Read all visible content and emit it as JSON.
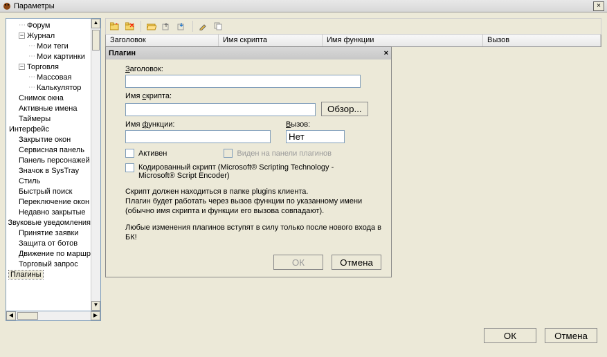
{
  "window": {
    "title": "Параметры",
    "close": "×"
  },
  "tree": {
    "items": [
      {
        "level": 1,
        "expander": "",
        "label": "Форум",
        "dots": true
      },
      {
        "level": 1,
        "expander": "−",
        "label": "Журнал",
        "dots": true
      },
      {
        "level": 2,
        "expander": "",
        "label": "Мои теги",
        "dots": true
      },
      {
        "level": 2,
        "expander": "",
        "label": "Мои картинки",
        "dots": true
      },
      {
        "level": 1,
        "expander": "−",
        "label": "Торговля",
        "dots": true
      },
      {
        "level": 2,
        "expander": "",
        "label": "Массовая",
        "dots": true
      },
      {
        "level": 2,
        "expander": "",
        "label": "Калькулятор",
        "dots": true
      },
      {
        "level": 1,
        "expander": "",
        "label": "Снимок окна",
        "dots": false
      },
      {
        "level": 1,
        "expander": "",
        "label": "Активные имена",
        "dots": false
      },
      {
        "level": 1,
        "expander": "",
        "label": "Таймеры",
        "dots": false
      },
      {
        "level": 0,
        "expander": "",
        "label": "Интерфейс",
        "dots": false
      },
      {
        "level": 1,
        "expander": "",
        "label": "Закрытие окон",
        "dots": false
      },
      {
        "level": 1,
        "expander": "",
        "label": "Сервисная панель",
        "dots": false
      },
      {
        "level": 1,
        "expander": "",
        "label": "Панель персонажей",
        "dots": false
      },
      {
        "level": 1,
        "expander": "",
        "label": "Значок в SysTray",
        "dots": false
      },
      {
        "level": 1,
        "expander": "",
        "label": "Стиль",
        "dots": false
      },
      {
        "level": 1,
        "expander": "",
        "label": "Быстрый поиск",
        "dots": false
      },
      {
        "level": 1,
        "expander": "",
        "label": "Переключение окон",
        "dots": false
      },
      {
        "level": 1,
        "expander": "",
        "label": "Недавно закрытые",
        "dots": false
      },
      {
        "level": 0,
        "expander": "",
        "label": "Звуковые уведомления",
        "dots": false
      },
      {
        "level": 1,
        "expander": "",
        "label": "Принятие заявки",
        "dots": false
      },
      {
        "level": 1,
        "expander": "",
        "label": "Защита от ботов",
        "dots": false
      },
      {
        "level": 1,
        "expander": "",
        "label": "Движение по маршр",
        "dots": false
      },
      {
        "level": 1,
        "expander": "",
        "label": "Торговый запрос",
        "dots": false
      },
      {
        "level": 0,
        "expander": "",
        "label": "Плагины",
        "dots": false,
        "selected": true
      }
    ]
  },
  "columns": {
    "c0": "Заголовок",
    "c1": "Имя скрипта",
    "c2": "Имя функции",
    "c3": "Вызов"
  },
  "dialog": {
    "title": "Плагин",
    "close": "×",
    "labels": {
      "header": "Заголовок:",
      "script": "Имя скрипта:",
      "func": "Имя функции:",
      "call": "Вызов:",
      "browse": "Обзор...",
      "active": "Активен",
      "visible": "Виден на панели плагинов",
      "encoded": "Кодированный скрипт (Microsoft® Scripting Technology - Microsoft® Script Encoder)"
    },
    "values": {
      "header": "",
      "script": "",
      "func": "",
      "call": "Нет",
      "active": false,
      "visible": false,
      "encoded": false
    },
    "help1": "Скрипт должен находиться в папке plugins клиента.\nПлагин будет работать через вызов функции по указанному имени (обычно имя скрипта и функции его вызова совпадают).",
    "help2": "Любые изменения плагинов вступят в силу только после нового входа в БК!",
    "ok": "ОК",
    "cancel": "Отмена"
  },
  "buttons": {
    "ok": "ОК",
    "cancel": "Отмена"
  },
  "scroll": {
    "up": "▲",
    "down": "▼",
    "left": "◀",
    "right": "▶"
  }
}
